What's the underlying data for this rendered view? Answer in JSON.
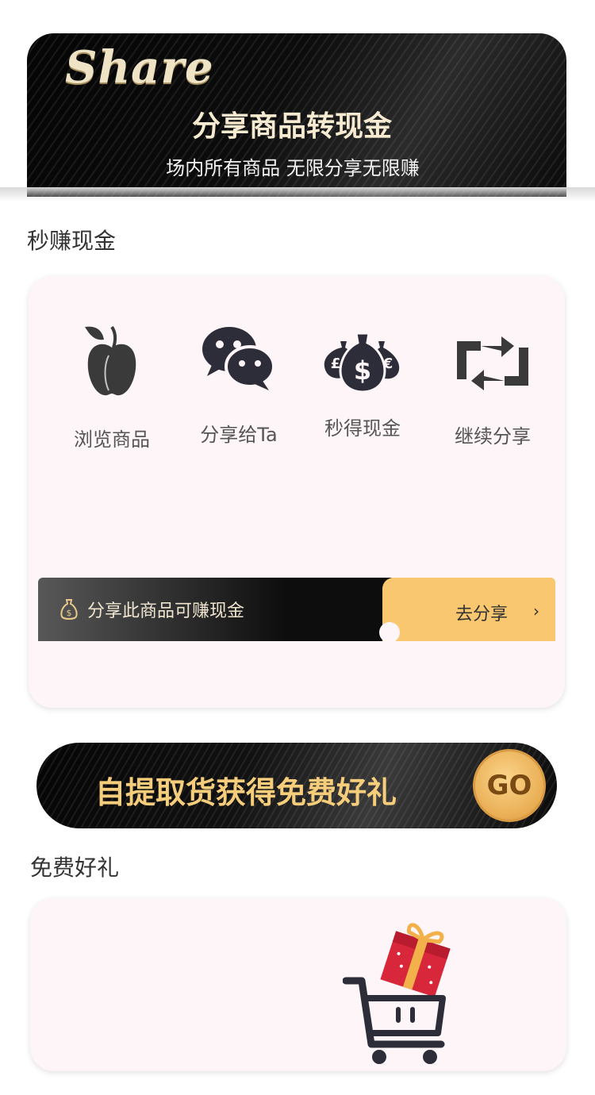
{
  "hero": {
    "share_word": "Share",
    "title": "分享商品转现金",
    "subtitle": "场内所有商品  无限分享无限赚"
  },
  "cash_section": {
    "label": "秒赚现金",
    "steps": [
      {
        "label": "浏览商品",
        "icon": "apple-icon"
      },
      {
        "label": "分享给Ta",
        "icon": "wechat-icon"
      },
      {
        "label": "秒得现金",
        "icon": "money-bags-icon"
      },
      {
        "label": "继续分享",
        "icon": "repeat-icon"
      }
    ],
    "share_bar": {
      "text": "分享此商品可赚现金",
      "button_label": "去分享",
      "chevron": "›"
    }
  },
  "pickup_banner": {
    "text": "自提取货获得免费好礼",
    "go_label": "GO"
  },
  "gift_section": {
    "label": "免费好礼"
  },
  "colors": {
    "accent_gold": "#f8c76f",
    "card_bg": "#fdf5f7",
    "icon_dark": "#2d2d3a",
    "gift_red": "#d8273a"
  }
}
